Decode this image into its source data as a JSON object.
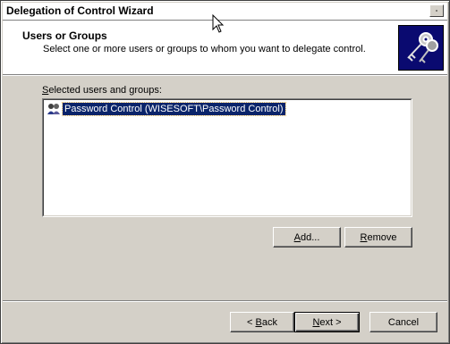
{
  "window": {
    "title": "Delegation of Control Wizard"
  },
  "header": {
    "title": "Users or Groups",
    "subtitle": "Select one or more users or groups to whom you want to delegate control."
  },
  "selection": {
    "label_underlined": "S",
    "label_rest": "elected users and groups:",
    "items": [
      {
        "label": "Password Control (WISESOFT\\Password Control)",
        "icon": "group-icon",
        "selected": true
      }
    ]
  },
  "buttons": {
    "add": {
      "underlined": "A",
      "rest": "dd..."
    },
    "remove": {
      "underlined": "R",
      "rest": "emove"
    },
    "back": {
      "prefix": "< ",
      "underlined": "B",
      "rest": "ack"
    },
    "next": {
      "underlined": "N",
      "rest": "ext >"
    },
    "cancel": {
      "label": "Cancel"
    }
  },
  "colors": {
    "face": "#d4d0c8",
    "selection": "#0a246a",
    "icon_bg": "#0a0a70"
  }
}
